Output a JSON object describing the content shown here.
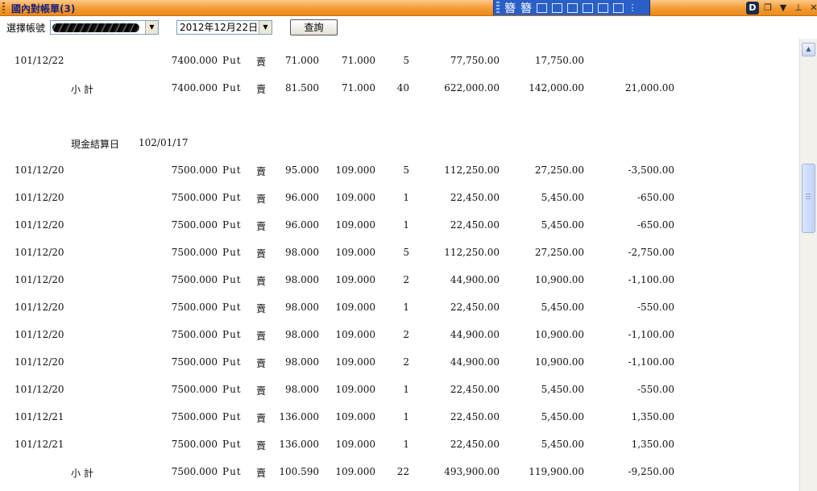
{
  "window": {
    "title": "國內對帳單(3)"
  },
  "ime_bar": {
    "chars": [
      "簪",
      "簪"
    ]
  },
  "toolbar": {
    "account_label": "選擇帳號",
    "date_value": "2012年12月22日",
    "query_label": "查詢"
  },
  "rows": [
    {
      "date": "101/12/22",
      "strike": "7400.000",
      "type": "Put",
      "side": "賣",
      "price": "71.000",
      "settle": "71.000",
      "qty": "5",
      "premium": "77,750.00",
      "margin": "17,750.00",
      "pnl": ""
    },
    {
      "kind": "subtotal",
      "label": "小計",
      "strike": "7400.000",
      "type": "Put",
      "side": "賣",
      "price": "81.500",
      "settle": "71.000",
      "qty": "40",
      "premium": "622,000.00",
      "margin": "142,000.00",
      "pnl": "21,000.00"
    },
    {
      "kind": "settle_header",
      "label": "現金結算日",
      "settle_date": "102/01/17"
    },
    {
      "date": "101/12/20",
      "strike": "7500.000",
      "type": "Put",
      "side": "賣",
      "price": "95.000",
      "settle": "109.000",
      "qty": "5",
      "premium": "112,250.00",
      "margin": "27,250.00",
      "pnl": "-3,500.00"
    },
    {
      "date": "101/12/20",
      "strike": "7500.000",
      "type": "Put",
      "side": "賣",
      "price": "96.000",
      "settle": "109.000",
      "qty": "1",
      "premium": "22,450.00",
      "margin": "5,450.00",
      "pnl": "-650.00"
    },
    {
      "date": "101/12/20",
      "strike": "7500.000",
      "type": "Put",
      "side": "賣",
      "price": "96.000",
      "settle": "109.000",
      "qty": "1",
      "premium": "22,450.00",
      "margin": "5,450.00",
      "pnl": "-650.00"
    },
    {
      "date": "101/12/20",
      "strike": "7500.000",
      "type": "Put",
      "side": "賣",
      "price": "98.000",
      "settle": "109.000",
      "qty": "5",
      "premium": "112,250.00",
      "margin": "27,250.00",
      "pnl": "-2,750.00"
    },
    {
      "date": "101/12/20",
      "strike": "7500.000",
      "type": "Put",
      "side": "賣",
      "price": "98.000",
      "settle": "109.000",
      "qty": "2",
      "premium": "44,900.00",
      "margin": "10,900.00",
      "pnl": "-1,100.00"
    },
    {
      "date": "101/12/20",
      "strike": "7500.000",
      "type": "Put",
      "side": "賣",
      "price": "98.000",
      "settle": "109.000",
      "qty": "1",
      "premium": "22,450.00",
      "margin": "5,450.00",
      "pnl": "-550.00"
    },
    {
      "date": "101/12/20",
      "strike": "7500.000",
      "type": "Put",
      "side": "賣",
      "price": "98.000",
      "settle": "109.000",
      "qty": "2",
      "premium": "44,900.00",
      "margin": "10,900.00",
      "pnl": "-1,100.00"
    },
    {
      "date": "101/12/20",
      "strike": "7500.000",
      "type": "Put",
      "side": "賣",
      "price": "98.000",
      "settle": "109.000",
      "qty": "2",
      "premium": "44,900.00",
      "margin": "10,900.00",
      "pnl": "-1,100.00"
    },
    {
      "date": "101/12/20",
      "strike": "7500.000",
      "type": "Put",
      "side": "賣",
      "price": "98.000",
      "settle": "109.000",
      "qty": "1",
      "premium": "22,450.00",
      "margin": "5,450.00",
      "pnl": "-550.00"
    },
    {
      "date": "101/12/21",
      "strike": "7500.000",
      "type": "Put",
      "side": "賣",
      "price": "136.000",
      "settle": "109.000",
      "qty": "1",
      "premium": "22,450.00",
      "margin": "5,450.00",
      "pnl": "1,350.00"
    },
    {
      "date": "101/12/21",
      "strike": "7500.000",
      "type": "Put",
      "side": "賣",
      "price": "136.000",
      "settle": "109.000",
      "qty": "1",
      "premium": "22,450.00",
      "margin": "5,450.00",
      "pnl": "1,350.00"
    },
    {
      "kind": "subtotal",
      "label": "小計",
      "strike": "7500.000",
      "type": "Put",
      "side": "賣",
      "price": "100.590",
      "settle": "109.000",
      "qty": "22",
      "premium": "493,900.00",
      "margin": "119,900.00",
      "pnl": "-9,250.00"
    }
  ]
}
